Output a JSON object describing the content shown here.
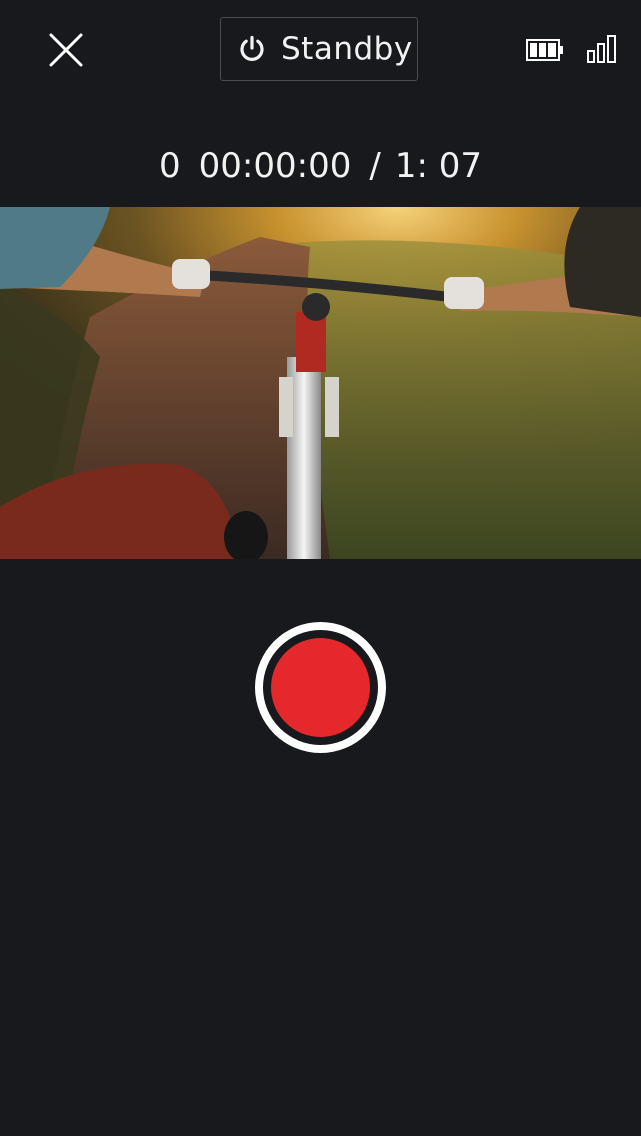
{
  "header": {
    "close_icon": "close-icon",
    "standby_label": "Standby",
    "standby_icon": "power-icon",
    "battery_icon": "battery-icon",
    "signal_icon": "signal-icon"
  },
  "status": {
    "count": "0",
    "elapsed": "00:00:00",
    "separator": "/",
    "remaining": "1: 07"
  },
  "preview": {
    "description_icon": "camera-preview"
  },
  "controls": {
    "record_icon": "record-icon",
    "record_color": "#e4282b"
  },
  "colors": {
    "background": "#17191d",
    "accent": "#e4282b",
    "text": "#f2f2f2"
  }
}
